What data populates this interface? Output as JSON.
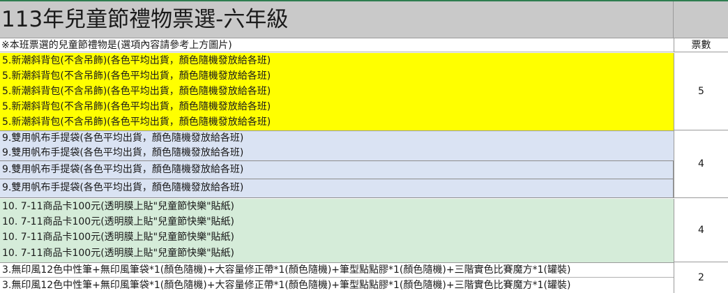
{
  "title": "113年兒童節禮物票選-六年級",
  "note": "※本班票選的兒童節禮物是(選項內容請參考上方圖片)",
  "vote_header": "票數",
  "colors": {
    "yellow": "#ffff00",
    "blue": "#dae3f3",
    "green": "#d5ecd9",
    "header": "#c9c9c9"
  },
  "groups": [
    {
      "votes": "5",
      "rows": [
        "5.新潮斜背包(不含吊飾)(各色平均出貨，顏色隨機發放給各班)",
        "5.新潮斜背包(不含吊飾)(各色平均出貨，顏色隨機發放給各班)",
        "5.新潮斜背包(不含吊飾)(各色平均出貨，顏色隨機發放給各班)",
        "5.新潮斜背包(不含吊飾)(各色平均出貨，顏色隨機發放給各班)",
        "5.新潮斜背包(不含吊飾)(各色平均出貨，顏色隨機發放給各班)"
      ]
    },
    {
      "votes": "4",
      "rows": [
        "9.雙用帆布手提袋(各色平均出貨，顏色隨機發放給各班)",
        "9.雙用帆布手提袋(各色平均出貨，顏色隨機發放給各班)",
        "9.雙用帆布手提袋(各色平均出貨，顏色隨機發放給各班)",
        "9.雙用帆布手提袋(各色平均出貨，顏色隨機發放給各班)"
      ]
    },
    {
      "votes": "4",
      "rows": [
        "10. 7-11商品卡100元(透明膜上貼\"兒童節快樂\"貼紙)",
        "10. 7-11商品卡100元(透明膜上貼\"兒童節快樂\"貼紙)",
        "10. 7-11商品卡100元(透明膜上貼\"兒童節快樂\"貼紙)",
        "10. 7-11商品卡100元(透明膜上貼\"兒童節快樂\"貼紙)"
      ]
    },
    {
      "votes": "2",
      "rows": [
        "3.無印風12色中性筆+無印風筆袋*1(顏色隨機)+大容量修正帶*1(顏色隨機)+筆型點點膠*1(顏色隨機)+三階實色比賽魔方*1(罐裝)",
        "3.無印風12色中性筆+無印風筆袋*1(顏色隨機)+大容量修正帶*1(顏色隨機)+筆型點點膠*1(顏色隨機)+三階實色比賽魔方*1(罐裝)"
      ]
    }
  ]
}
